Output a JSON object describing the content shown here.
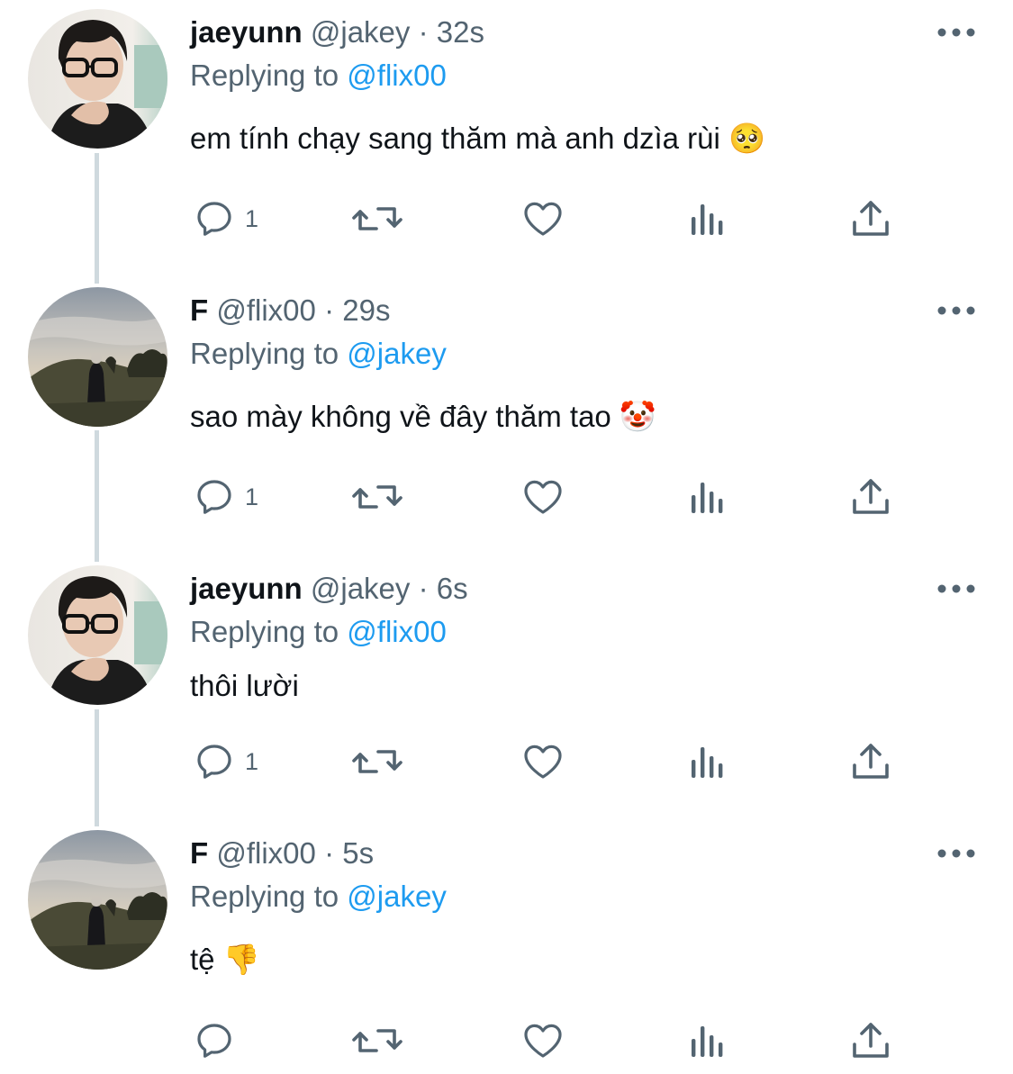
{
  "tweets": [
    {
      "name": "jaeyunn",
      "handle": "@jakey",
      "separator": "·",
      "time": "32s",
      "replying_prefix": "Replying to",
      "replying_handle": "@flix00",
      "text": "em tính chạy sang thăm mà anh dzìa rùi 🥺",
      "avatar": "person-with-glasses-avatar",
      "reply_count": "1"
    },
    {
      "name": "F",
      "handle": "@flix00",
      "separator": "·",
      "time": "29s",
      "replying_prefix": "Replying to",
      "replying_handle": "@jakey",
      "text": "sao mày không về đây thăm tao 🤡",
      "avatar": "person-in-field-avatar",
      "reply_count": "1"
    },
    {
      "name": "jaeyunn",
      "handle": "@jakey",
      "separator": "·",
      "time": "6s",
      "replying_prefix": "Replying to",
      "replying_handle": "@flix00",
      "text": "thôi lười",
      "avatar": "person-with-glasses-avatar",
      "reply_count": "1"
    },
    {
      "name": "F",
      "handle": "@flix00",
      "separator": "·",
      "time": "5s",
      "replying_prefix": "Replying to",
      "replying_handle": "@jakey",
      "text": "tệ 👎",
      "avatar": "person-in-field-avatar",
      "reply_count": ""
    }
  ],
  "icons": {
    "more": "more-horizontal-icon",
    "reply": "reply-bubble-icon",
    "retweet": "retweet-icon",
    "like": "heart-icon",
    "views": "views-bar-chart-icon",
    "share": "share-upload-icon"
  },
  "colors": {
    "name": "#0f1419",
    "secondary": "#536471",
    "mention": "#1d9bf0",
    "thread_line": "#cfd9de"
  }
}
